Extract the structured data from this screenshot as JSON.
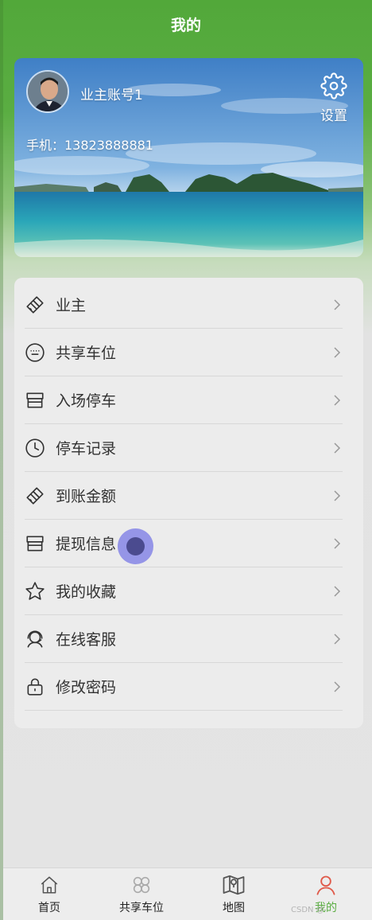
{
  "header": {
    "title": "我的"
  },
  "profile": {
    "account_name": "业主账号1",
    "phone": "手机：13823888881",
    "settings_label": "设置"
  },
  "menu": {
    "items": [
      {
        "label": "业主",
        "icon": "brush-icon"
      },
      {
        "label": "共享车位",
        "icon": "keyboard-icon"
      },
      {
        "label": "入场停车",
        "icon": "store-icon"
      },
      {
        "label": "停车记录",
        "icon": "clock-icon"
      },
      {
        "label": "到账金额",
        "icon": "brush-icon"
      },
      {
        "label": "提现信息",
        "icon": "store-icon"
      },
      {
        "label": "我的收藏",
        "icon": "star-icon"
      },
      {
        "label": "在线客服",
        "icon": "headset-icon"
      },
      {
        "label": "修改密码",
        "icon": "lock-icon"
      }
    ]
  },
  "tabbar": {
    "items": [
      {
        "label": "首页",
        "icon": "home-icon",
        "active": false
      },
      {
        "label": "共享车位",
        "icon": "clover-icon",
        "active": false
      },
      {
        "label": "地图",
        "icon": "map-icon",
        "active": false
      },
      {
        "label": "我的",
        "icon": "person-icon",
        "active": true
      }
    ]
  },
  "watermark": "CSDN @",
  "colors": {
    "brand_green": "#5aad42",
    "text": "#333333",
    "card": "#ececec"
  }
}
